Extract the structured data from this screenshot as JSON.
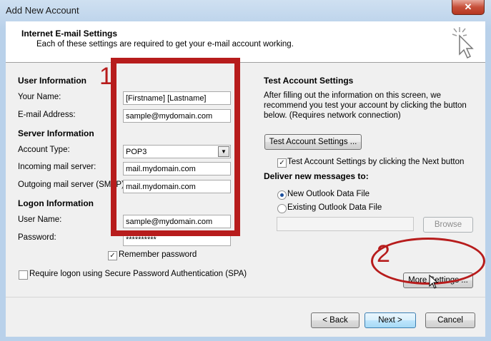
{
  "window": {
    "title": "Add New Account",
    "close_label": "✕"
  },
  "header": {
    "title": "Internet E-mail Settings",
    "subtitle": "Each of these settings are required to get your e-mail account working.",
    "icon": "cursor-sparkle-icon"
  },
  "user_info": {
    "heading": "User Information",
    "name_label": "Your Name:",
    "name_value": "[Firstname] [Lastname]",
    "email_label": "E-mail Address:",
    "email_value": "sample@mydomain.com"
  },
  "server_info": {
    "heading": "Server Information",
    "account_type_label": "Account Type:",
    "account_type_value": "POP3",
    "incoming_label": "Incoming mail server:",
    "incoming_value": "mail.mydomain.com",
    "outgoing_label": "Outgoing mail server (SMTP):",
    "outgoing_value": "mail.mydomain.com"
  },
  "logon_info": {
    "heading": "Logon Information",
    "user_label": "User Name:",
    "user_value": "sample@mydomain.com",
    "password_label": "Password:",
    "password_value": "**********",
    "remember_label": "Remember password",
    "remember_checked": true,
    "spa_label": "Require logon using Secure Password Authentication (SPA)",
    "spa_checked": false
  },
  "test_settings": {
    "heading": "Test Account Settings",
    "description": [
      "After filling out the information on this screen, we",
      "recommend you test your account by clicking the button",
      "below. (Requires network connection)"
    ],
    "test_button": "Test Account Settings ...",
    "auto_test_label": "Test Account Settings by clicking the Next button",
    "auto_test_checked": true
  },
  "deliver": {
    "heading": "Deliver new messages to:",
    "option_new": "New Outlook Data File",
    "option_existing": "Existing Outlook Data File",
    "selected": "new",
    "path_value": "",
    "browse_button": "Browse"
  },
  "more_settings_button": "More Settings ...",
  "footer": {
    "back": "< Back",
    "next": "Next >",
    "cancel": "Cancel"
  },
  "annotations": {
    "marker_1": "1",
    "marker_2": "2",
    "color": "#b71c1c"
  }
}
